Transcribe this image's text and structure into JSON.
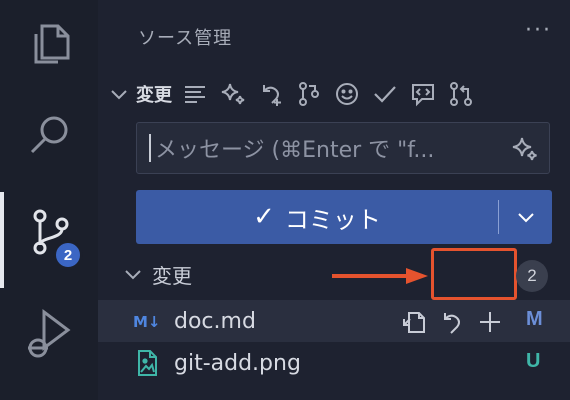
{
  "activity_bar": {
    "source_control_badge": "2"
  },
  "sidebar": {
    "view_title": "ソース管理",
    "more_label": "···",
    "section": {
      "title": "変更",
      "toolbar_icons": [
        "list-icon",
        "sparkle-icon",
        "undo-icon",
        "branch-compare-icon",
        "smiley-icon",
        "check-icon",
        "comment-code-icon",
        "pull-request-icon"
      ]
    },
    "commit_input": {
      "placeholder": "メッセージ (⌘Enter で \"f..."
    },
    "commit_button": {
      "check": "✓",
      "label": "コミット"
    },
    "changes_group": {
      "title": "変更",
      "count": "2"
    },
    "files": [
      {
        "name": "doc.md",
        "status": "M",
        "status_color": "#6c8fd8",
        "icon": "markdown-icon"
      },
      {
        "name": "git-add.png",
        "status": "U",
        "status_color": "#3fb6a8",
        "icon": "image-icon"
      }
    ]
  },
  "colors": {
    "accent": "#3b5ba5",
    "highlight": "#e5532e"
  }
}
